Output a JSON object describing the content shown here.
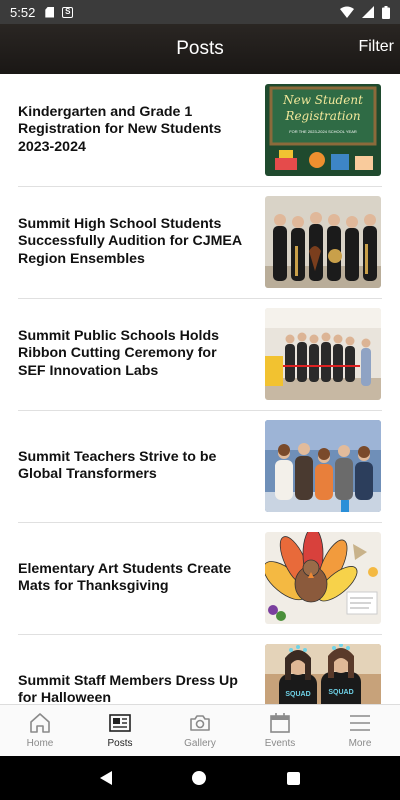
{
  "status_bar": {
    "time": "5:52"
  },
  "header": {
    "title": "Posts",
    "filter_label": "Filter"
  },
  "posts": [
    {
      "title": "Kindergarten and Grade 1 Registration for New Students 2023-2024",
      "thumb_text": "New Student Registration",
      "thumb_sub": "FOR THE 2023-2024 SCHOOL YEAR"
    },
    {
      "title": "Summit High School Students Successfully Audition for CJMEA Region Ensembles"
    },
    {
      "title": "Summit Public Schools Holds Ribbon Cutting Ceremony for SEF Innovation Labs"
    },
    {
      "title": "Summit Teachers Strive to be Global Transformers"
    },
    {
      "title": "Elementary Art Students Create Mats for Thanksgiving"
    },
    {
      "title": "Summit Staff Members Dress Up for Halloween",
      "thumb_text": "SQUAD"
    }
  ],
  "bottom_nav": {
    "items": [
      {
        "label": "Home",
        "icon": "home-icon"
      },
      {
        "label": "Posts",
        "icon": "posts-icon",
        "active": true
      },
      {
        "label": "Gallery",
        "icon": "camera-icon"
      },
      {
        "label": "Events",
        "icon": "calendar-icon"
      },
      {
        "label": "More",
        "icon": "menu-icon"
      }
    ]
  }
}
